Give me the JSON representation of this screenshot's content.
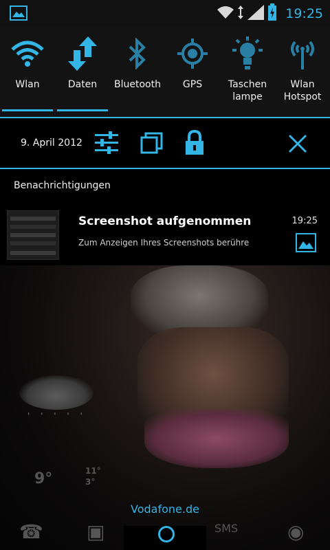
{
  "statusbar": {
    "time": "19:25",
    "icons": [
      "gallery-icon",
      "wifi-icon",
      "data-arrows-icon",
      "signal-icon",
      "battery-charging-icon"
    ]
  },
  "quick_settings": [
    {
      "label": "Wlan",
      "icon": "wifi-icon",
      "active": true
    },
    {
      "label": "Daten",
      "icon": "data-transfer-icon",
      "active": true
    },
    {
      "label": "Bluetooth",
      "icon": "bluetooth-icon",
      "active": false
    },
    {
      "label": "GPS",
      "icon": "gps-icon",
      "active": false
    },
    {
      "label": "Taschen\nlampe",
      "icon": "flashlight-icon",
      "active": false
    },
    {
      "label": "Wlan\nHotspot",
      "icon": "hotspot-icon",
      "active": false
    }
  ],
  "datebar": {
    "date": "9. April 2012",
    "icons": [
      "settings-sliders-icon",
      "recent-apps-icon",
      "lock-icon",
      "close-icon"
    ]
  },
  "notifications": {
    "header": "Benachrichtigungen",
    "items": [
      {
        "title": "Screenshot aufgenommen",
        "time": "19:25",
        "text": "Zum Anzeigen Ihres Screenshots berühre",
        "icon": "gallery-icon"
      }
    ]
  },
  "homescreen": {
    "carrier": "Vodafone.de",
    "weather": {
      "temp_main": "9°",
      "temp_high": "11°",
      "temp_low": "3°"
    }
  },
  "colors": {
    "accent": "#33b5e5",
    "background": "#000000"
  }
}
